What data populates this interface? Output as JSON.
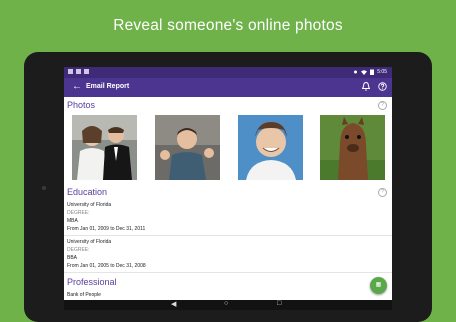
{
  "headline": "Reveal someone's online photos",
  "app": {
    "title": "Email Report",
    "time": "5:05"
  },
  "sections": {
    "photos": "Photos",
    "education": "Education",
    "professional": "Professional"
  },
  "education": [
    {
      "school": "University of Florida",
      "degree_label": "DEGREE:",
      "degree": "MBA",
      "dates": "From Jan 01, 2009 to Dec 31, 2011"
    },
    {
      "school": "University of Florida",
      "degree_label": "DEGREE:",
      "degree": "BBA",
      "dates": "From Jan 01, 2005 to Dec 31, 2008"
    }
  ],
  "professional": [
    {
      "employer": "Bank of People"
    }
  ],
  "icons": {
    "back": "back-arrow-icon",
    "alert": "alert-icon",
    "help": "help-icon",
    "fab": "fab-icon"
  },
  "colors": {
    "background": "#6fb24a",
    "appbar": "#4b3591",
    "section_title": "#5a3d9e",
    "fab": "#5aa84a"
  }
}
